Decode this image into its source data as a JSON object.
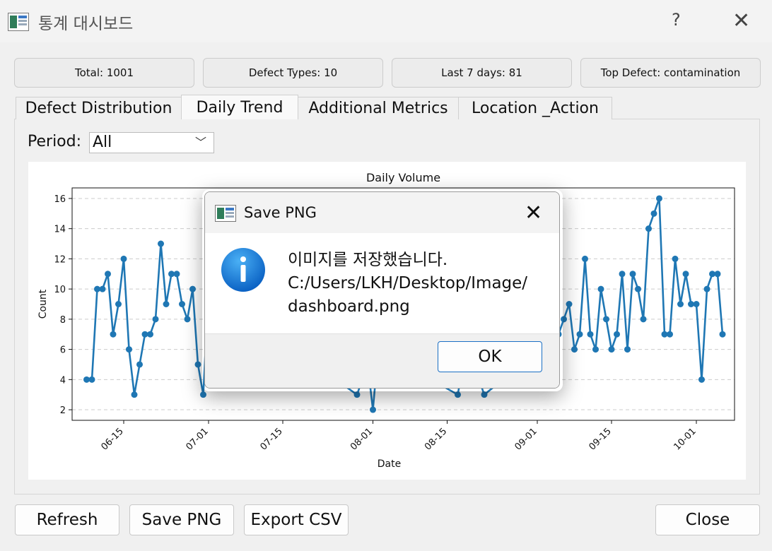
{
  "window": {
    "title": "통계 대시보드",
    "help_glyph": "?",
    "close_glyph": "✕"
  },
  "stats": [
    {
      "label": "Total: 1001"
    },
    {
      "label": "Defect Types: 10"
    },
    {
      "label": "Last 7 days: 81"
    },
    {
      "label": "Top Defect: contamination"
    }
  ],
  "tabs": [
    {
      "label": "Defect Distribution",
      "active": false
    },
    {
      "label": "Daily Trend",
      "active": true
    },
    {
      "label": "Additional Metrics",
      "active": false
    },
    {
      "label": "Location _Action",
      "active": false
    }
  ],
  "period": {
    "label": "Period:",
    "value": "All"
  },
  "chart_data": {
    "type": "line",
    "title": "Daily Volume",
    "xlabel": "Date",
    "ylabel": "Count",
    "ylim": [
      1.3,
      16.7
    ],
    "yticks": [
      2,
      4,
      6,
      8,
      10,
      12,
      14,
      16
    ],
    "xticks": [
      "06-15",
      "07-01",
      "07-15",
      "08-01",
      "08-15",
      "09-01",
      "09-15",
      "10-01"
    ],
    "grid": "horizontal dashed",
    "color": "#1f77b4",
    "x": [
      "06-08",
      "06-09",
      "06-10",
      "06-11",
      "06-12",
      "06-13",
      "06-14",
      "06-15",
      "06-16",
      "06-17",
      "06-18",
      "06-19",
      "06-20",
      "06-21",
      "06-22",
      "06-23",
      "06-24",
      "06-25",
      "06-26",
      "06-27",
      "06-28",
      "06-29",
      "06-30",
      "07-01",
      "07-29",
      "07-30",
      "07-31",
      "08-01",
      "08-02",
      "08-17",
      "08-18",
      "08-19",
      "08-20",
      "08-21",
      "08-22",
      "09-05",
      "09-06",
      "09-07",
      "09-08",
      "09-09",
      "09-10",
      "09-11",
      "09-12",
      "09-13",
      "09-14",
      "09-15",
      "09-16",
      "09-17",
      "09-18",
      "09-19",
      "09-20",
      "09-21",
      "09-22",
      "09-23",
      "09-24",
      "09-25",
      "09-26",
      "09-27",
      "09-28",
      "09-29",
      "09-30",
      "10-01",
      "10-02",
      "10-03",
      "10-04",
      "10-05"
    ],
    "values": [
      4,
      4,
      10,
      10,
      11,
      7,
      9,
      12,
      6,
      3,
      5,
      7,
      7,
      8,
      13,
      9,
      11,
      11,
      9,
      8,
      10,
      5,
      3,
      10,
      3,
      4,
      5,
      2,
      6,
      3,
      5,
      6,
      5,
      4,
      3,
      7,
      8,
      9,
      6,
      7,
      12,
      7,
      6,
      10,
      8,
      6,
      7,
      11,
      6,
      11,
      10,
      8,
      14,
      15,
      16,
      7,
      7,
      12,
      9,
      11,
      9,
      9,
      4,
      10,
      11,
      11
    ],
    "tail_value": 7
  },
  "buttons": {
    "refresh": "Refresh",
    "save_png": "Save PNG",
    "export_csv": "Export CSV",
    "close": "Close"
  },
  "dialog": {
    "title": "Save PNG",
    "close_glyph": "✕",
    "message_line1": "이미지를 저장했습니다.",
    "message_line2": "C:/Users/LKH/Desktop/Image/",
    "message_line3": "dashboard.png",
    "ok": "OK",
    "icon": "information-icon"
  },
  "icons": {
    "app": "app-chart-icon",
    "dropdown": "chevron-down-icon"
  }
}
